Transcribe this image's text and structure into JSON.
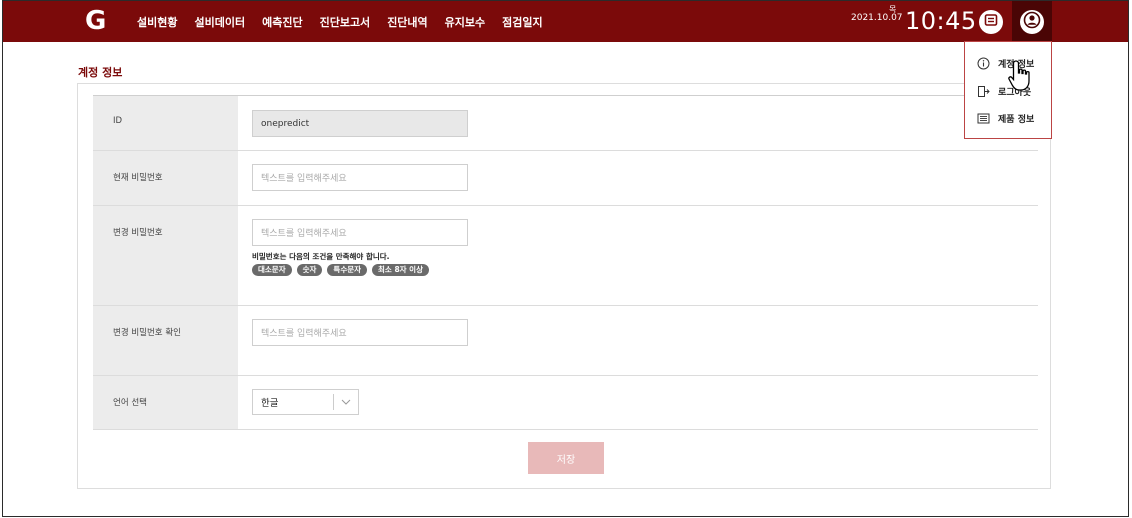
{
  "header": {
    "logo": "G",
    "nav": [
      "설비현황",
      "설비데이터",
      "예측진단",
      "진단보고서",
      "진단내역",
      "유지보수",
      "점검일지"
    ],
    "date": "2021.10.07",
    "day_of_week": "목",
    "time": "10:45"
  },
  "user_menu": {
    "items": [
      {
        "label": "계정 정보",
        "icon": "info-circle-icon"
      },
      {
        "label": "로그아웃",
        "icon": "logout-icon"
      },
      {
        "label": "제품 정보",
        "icon": "product-info-icon"
      }
    ]
  },
  "page": {
    "title": "계정 정보"
  },
  "form": {
    "id_label": "ID",
    "id_value": "onepredict",
    "current_pw_label": "현재 비밀번호",
    "current_pw_placeholder": "텍스트를 입력해주세요",
    "new_pw_label": "변경 비밀번호",
    "new_pw_placeholder": "텍스트를 입력해주세요",
    "pw_rule_hint": "비밀번호는 다음의 조건을 만족해야 합니다.",
    "pw_rules": [
      "대소문자",
      "숫자",
      "특수문자",
      "최소 8자 이상"
    ],
    "confirm_pw_label": "변경 비밀번호 확인",
    "confirm_pw_placeholder": "텍스트를 입력해주세요",
    "language_label": "언어 선택",
    "language_value": "한글"
  },
  "actions": {
    "save_label": "저장"
  },
  "colors": {
    "brand": "#7b0a0a",
    "save_disabled": "#e8b9b9"
  }
}
